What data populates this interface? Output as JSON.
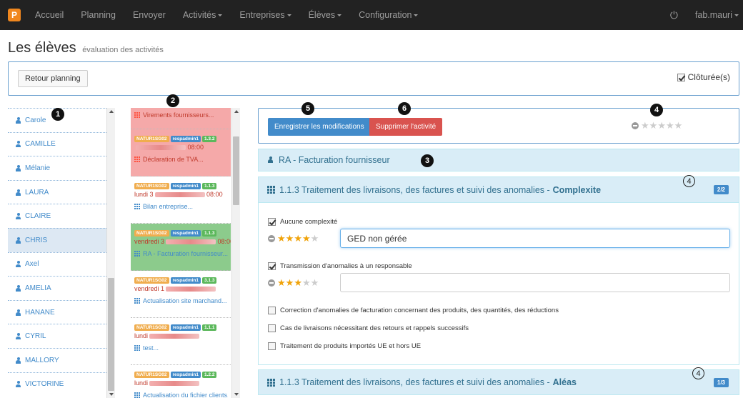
{
  "nav": {
    "logo": "P",
    "items": [
      {
        "label": "Accueil",
        "dropdown": false
      },
      {
        "label": "Planning",
        "dropdown": false
      },
      {
        "label": "Envoyer",
        "dropdown": false
      },
      {
        "label": "Activités",
        "dropdown": true
      },
      {
        "label": "Entreprises",
        "dropdown": true
      },
      {
        "label": "Élèves",
        "dropdown": true
      },
      {
        "label": "Configuration",
        "dropdown": true
      }
    ],
    "user": "fab.mauri"
  },
  "page": {
    "title": "Les élèves",
    "subtitle": "évaluation des activités"
  },
  "toolbar": {
    "back_label": "Retour planning",
    "closed_label": "Clôturée(s)",
    "closed_checked": true
  },
  "markers": [
    "1",
    "2",
    "3",
    "4",
    "5",
    "6",
    "4",
    "4"
  ],
  "students": [
    {
      "name": "Carole",
      "selected": false
    },
    {
      "name": "CAMILLE",
      "selected": false
    },
    {
      "name": "Mélanie",
      "selected": false
    },
    {
      "name": "LAURA",
      "selected": false
    },
    {
      "name": "CLAIRE",
      "selected": false
    },
    {
      "name": "CHRIS",
      "selected": true
    },
    {
      "name": "Axel",
      "selected": false
    },
    {
      "name": "AMELIA",
      "selected": false
    },
    {
      "name": "HANANE",
      "selected": false
    },
    {
      "name": "CYRIL",
      "selected": false
    },
    {
      "name": "MALLORY",
      "selected": false
    },
    {
      "name": "VICTORINE",
      "selected": false
    }
  ],
  "activities": [
    {
      "title": "Virements fournisseurs...",
      "state": "red",
      "badges": [],
      "day": "",
      "time": ""
    },
    {
      "title": "Déclaration de TVA...",
      "state": "red",
      "badges": [
        "NATUR1SG02",
        "respadmin1",
        "1.3.2"
      ],
      "day": "",
      "time": "08:00"
    },
    {
      "title": "Bilan entreprise...",
      "state": "none",
      "badges": [
        "NATUR1SG02",
        "respadmin1",
        "1.1.3"
      ],
      "day": "lundi 3",
      "time": "08:00"
    },
    {
      "title": "RA - Facturation fournisseur...",
      "state": "green",
      "badges": [
        "NATUR1SG02",
        "respadmin1",
        "1.1.3"
      ],
      "day": "vendredi 3",
      "time": "08:00"
    },
    {
      "title": "Actualisation site marchand...",
      "state": "none",
      "badges": [
        "NATUR1SG02",
        "respadmin1",
        "3.1.3"
      ],
      "day": "vendredi 1",
      "time": ""
    },
    {
      "title": "test...",
      "state": "none",
      "badges": [
        "NATUR1SG02",
        "respadmin1",
        "1.1.1"
      ],
      "day": "lundi",
      "time": ""
    },
    {
      "title": "Actualisation du fichier clients...",
      "state": "none",
      "badges": [
        "NATUR1SG02",
        "respadmin1",
        "1.2.2"
      ],
      "day": "lundi",
      "time": ""
    }
  ],
  "actions": {
    "save_label": "Enregistrer les modifications",
    "delete_label": "Supprimer l'activité",
    "global_rating": 0,
    "max_rating": 5
  },
  "ra": {
    "title": "RA - Facturation fournisseur"
  },
  "panel1": {
    "title": "1.1.3 Traitement des livraisons, des factures et suivi des anomalies - ",
    "title_bold": "Complexite",
    "count": "2/2",
    "criteria": [
      {
        "label": "Aucune complexité",
        "checked": true,
        "rating": 4,
        "comment": "GED non gérée"
      },
      {
        "label": "Transmission d'anomalies à un responsable",
        "checked": true,
        "rating": 3,
        "comment": ""
      },
      {
        "label": "Correction d'anomalies de facturation concernant des produits, des quantités, des réductions",
        "checked": false
      },
      {
        "label": "Cas de livraisons nécessitant des retours et rappels successifs",
        "checked": false
      },
      {
        "label": "Traitement de produits importés UE et hors UE",
        "checked": false
      }
    ]
  },
  "panel2": {
    "title": "1.1.3 Traitement des livraisons, des factures et suivi des anomalies - ",
    "title_bold": "Aléas",
    "count": "1/3"
  },
  "colors": {
    "navbar": "#222222",
    "primary": "#428bca",
    "danger": "#d9534f",
    "success": "#5cb85c",
    "warning": "#f0ad4e",
    "star": "#f0a30a"
  }
}
